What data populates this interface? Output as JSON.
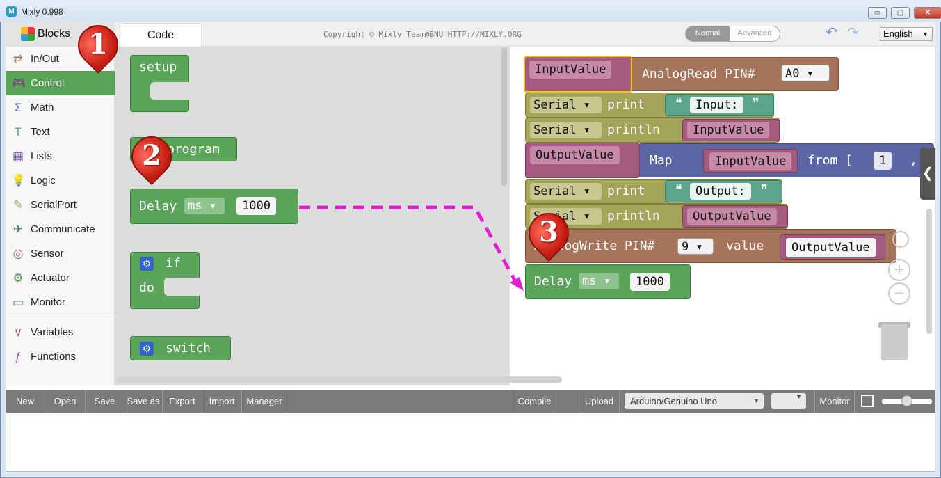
{
  "window": {
    "title": "Mixly 0.998",
    "min_glyph": "▭",
    "max_glyph": "▢",
    "close_glyph": "✕",
    "app_icon_glyph": "M"
  },
  "header": {
    "tab_blocks": "Blocks",
    "tab_code": "Code",
    "copyright": "Copyright © Mixly Team@BNU HTTP://MIXLY.ORG",
    "mode_normal": "Normal",
    "mode_advanced": "Advanced",
    "undo_glyph": "↶",
    "redo_glyph": "↷",
    "language": "English",
    "arrow_glyph": "▼"
  },
  "sidebar": {
    "items": [
      {
        "label": "In/Out",
        "icon": "⇄",
        "color": "#a5745b"
      },
      {
        "label": "Control",
        "icon": "🎮",
        "color": "#ffffff"
      },
      {
        "label": "Math",
        "icon": "Σ",
        "color": "#5b67a5"
      },
      {
        "label": "Text",
        "icon": "T",
        "color": "#5ba58c"
      },
      {
        "label": "Lists",
        "icon": "▦",
        "color": "#745ba5"
      },
      {
        "label": "Logic",
        "icon": "💡",
        "color": "#5b80a5"
      },
      {
        "label": "SerialPort",
        "icon": "✎",
        "color": "#a5a55a"
      },
      {
        "label": "Communicate",
        "icon": "✈",
        "color": "#3e7c68"
      },
      {
        "label": "Sensor",
        "icon": "◎",
        "color": "#a5745b"
      },
      {
        "label": "Actuator",
        "icon": "⚙",
        "color": "#5ba55b"
      },
      {
        "label": "Monitor",
        "icon": "▭",
        "color": "#1c7c8c"
      },
      {
        "label": "Variables",
        "icon": "∨",
        "color": "#a55b80"
      },
      {
        "label": "Functions",
        "icon": "ƒ",
        "color": "#995ba5"
      }
    ],
    "selected": "Control"
  },
  "flyout": {
    "setup": "setup",
    "program": "program",
    "delay": "Delay",
    "delay_unit": "ms",
    "delay_value": "1000",
    "if": "if",
    "do": "do",
    "switch": "switch",
    "gear_glyph": "⚙"
  },
  "workspace": {
    "b1": {
      "var": "InputValue",
      "fn": "AnalogRead PIN#",
      "pin": "A0"
    },
    "b2": {
      "port": "Serial",
      "fn": "print",
      "text": "Input:",
      "lq": "❝",
      "rq": "❞"
    },
    "b3": {
      "port": "Serial",
      "fn": "println",
      "var": "InputValue"
    },
    "b4": {
      "var": "OutputValue",
      "fn": "Map",
      "arg": "InputValue",
      "from": "from [",
      "n": "1",
      "comma": ","
    },
    "b5": {
      "port": "Serial",
      "fn": "print",
      "text": "Output:"
    },
    "b6": {
      "port": "Serial",
      "fn": "println",
      "var": "OutputValue"
    },
    "b7": {
      "fn": "AnalogWrite PIN#",
      "pin": "9",
      "value_label": "value",
      "var": "OutputValue"
    },
    "b8": {
      "fn": "Delay",
      "unit": "ms",
      "value": "1000"
    },
    "zoom_in": "+",
    "zoom_out": "−",
    "side_toggle": "❮"
  },
  "markers": [
    "1",
    "2",
    "3"
  ],
  "toolbar": {
    "new": "New",
    "open": "Open",
    "save": "Save",
    "save_as": "Save as",
    "export": "Export",
    "import": "Import",
    "manager": "Manager",
    "compile": "Compile",
    "upload": "Upload",
    "board": "Arduino/Genuino Uno",
    "port": "",
    "monitor": "Monitor"
  },
  "colors": {
    "control_green": "#5ba55b",
    "serial_olive": "#a5a55a",
    "inout_brown": "#a5745b",
    "variable_purple": "#a55b80",
    "text_teal": "#5ba58c",
    "math_indigo": "#5b67a5",
    "marker_red": "#c41a10",
    "arrow_magenta": "#e020d0"
  }
}
